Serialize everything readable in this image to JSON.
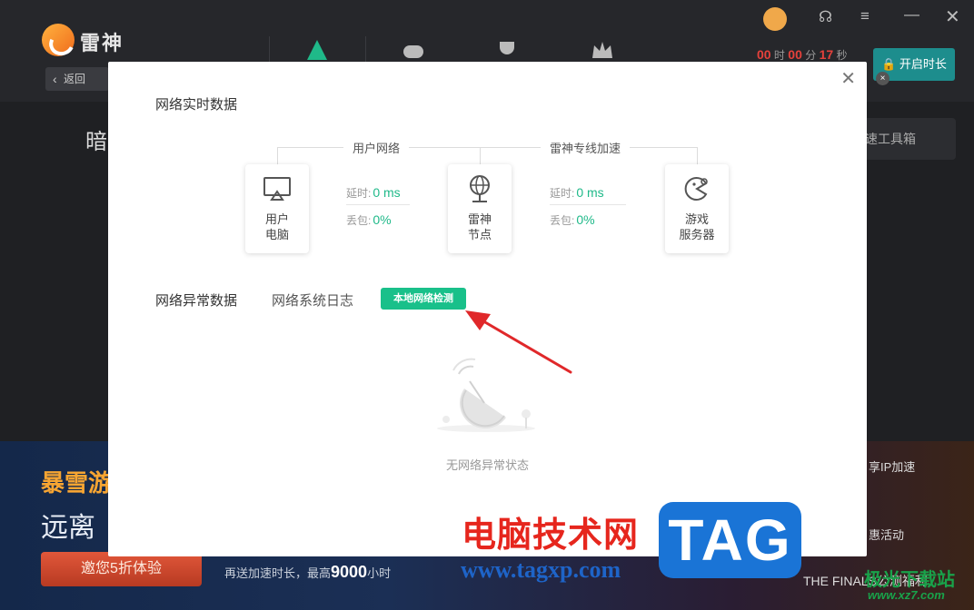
{
  "app": {
    "logo_text": "雷神",
    "back_label": "返回",
    "timer": {
      "hours": "00",
      "hours_unit": "时",
      "minutes": "00",
      "minutes_unit": "分",
      "seconds": "17",
      "seconds_unit": "秒"
    },
    "start_button": "开启时长",
    "bg_title": "暗",
    "toolbox_label": "速工具箱"
  },
  "banner": {
    "title1": "暴雪游",
    "title2": "远离",
    "cta_button": "邀您5折体验",
    "note_prefix": "再送加速时长，最高",
    "note_highlight": "9000",
    "note_suffix": "小时",
    "right_item1": "享IP加速",
    "right_item2": "惠活动",
    "finals_text": "THE FINALS公测福利"
  },
  "modal": {
    "realtime_title": "网络实时数据",
    "user_network_label": "用户网络",
    "leishen_line_label": "雷神专线加速",
    "nodes": [
      {
        "label": "用户\n电脑"
      },
      {
        "label": "雷神\n节点"
      },
      {
        "label": "游戏\n服务器"
      }
    ],
    "segment1": {
      "latency_label": "延时:",
      "latency_value": "0 ms",
      "loss_label": "丢包:",
      "loss_value": "0%"
    },
    "segment2": {
      "latency_label": "延时:",
      "latency_value": "0 ms",
      "loss_label": "丢包:",
      "loss_value": "0%"
    },
    "tabs": {
      "anomaly": "网络异常数据",
      "syslog": "网络系统日志"
    },
    "check_button": "本地网络检测",
    "empty_text": "无网络异常状态"
  },
  "watermarks": {
    "cn_site": "电脑技术网",
    "url": "www.tagxp.com",
    "tag": "TAG",
    "jiguang": "极光下载站",
    "xz": "www.xz7.com"
  },
  "colors": {
    "accent_green": "#19c08a",
    "value_green": "#1fb989",
    "arrow_red": "#e0282a",
    "banner_btn": "#c9462b"
  }
}
